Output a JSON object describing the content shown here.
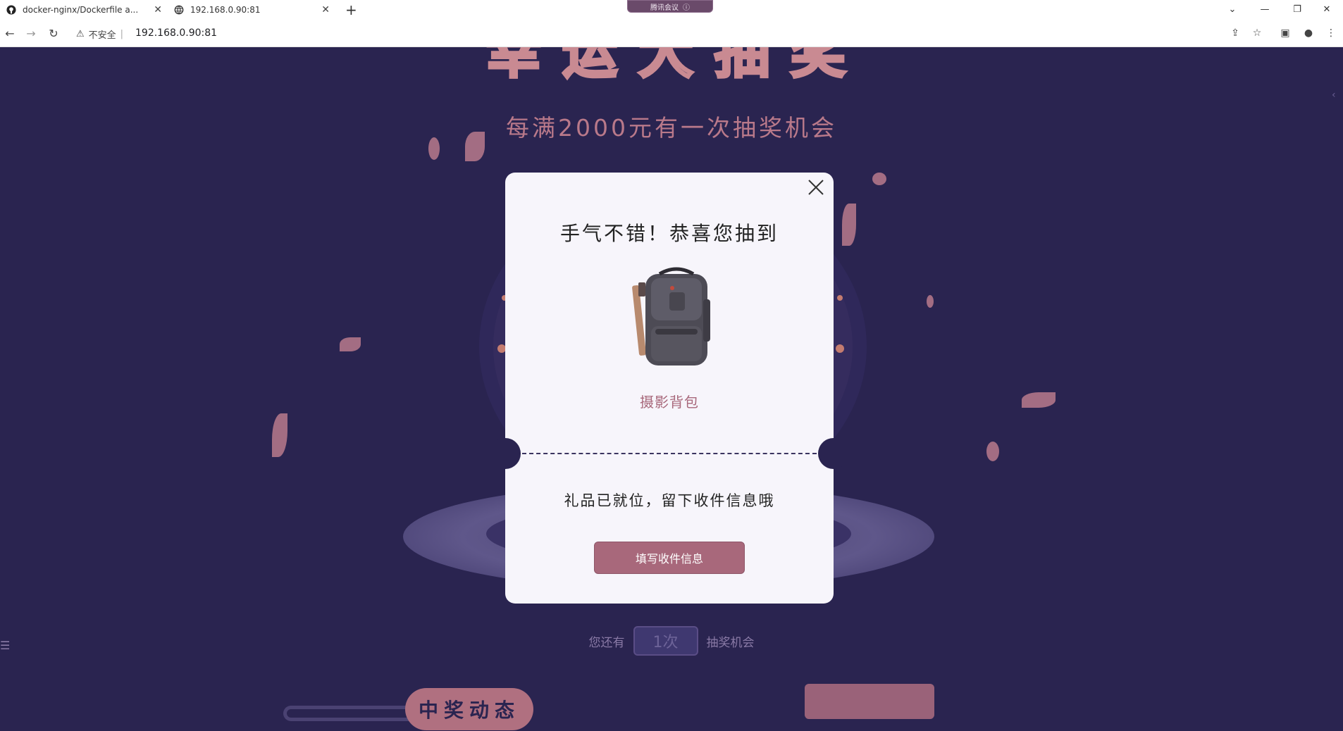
{
  "browser": {
    "tabs": [
      {
        "title": "docker-nginx/Dockerfile a...",
        "icon": "github-icon"
      },
      {
        "title": "192.168.0.90:81",
        "icon": "globe-icon"
      }
    ],
    "meeting_pill": "腾讯会议",
    "security_label": "不安全",
    "url": "192.168.0.90:81"
  },
  "page": {
    "subtitle": "每满2000元有一次抽奖机会",
    "chances": {
      "prefix": "您还有",
      "count": "1次",
      "suffix": "抽奖机会"
    },
    "winners_badge": "中奖动态"
  },
  "modal": {
    "title": "手气不错！恭喜您抽到",
    "prize_name": "摄影背包",
    "prize_icon": "camera-backpack-image",
    "gift_note": "礼品已就位，留下收件信息哦",
    "fill_button": "填写收件信息"
  },
  "colors": {
    "page_bg": "#2a2450",
    "accent": "#a8687b",
    "modal_bg": "#f7f5fb"
  }
}
